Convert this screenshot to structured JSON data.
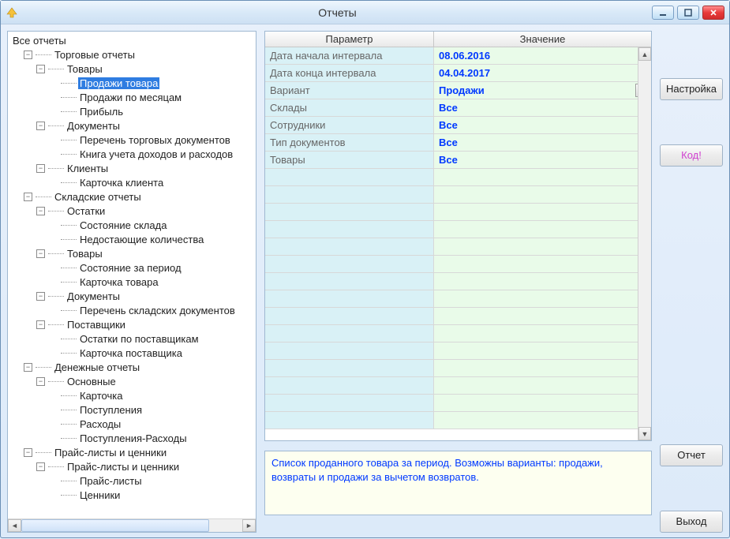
{
  "window": {
    "title": "Отчеты",
    "min_tip": "Свернуть",
    "max_tip": "Развернуть",
    "close_tip": "Закрыть"
  },
  "tree": {
    "root_label": "Все отчеты",
    "groups": [
      {
        "label": "Торговые отчеты",
        "children": [
          {
            "label": "Товары",
            "children": [
              {
                "label": "Продажи товара",
                "selected": true
              },
              {
                "label": "Продажи по месяцам"
              },
              {
                "label": "Прибыль"
              }
            ]
          },
          {
            "label": "Документы",
            "children": [
              {
                "label": "Перечень торговых документов"
              },
              {
                "label": "Книга учета доходов и расходов"
              }
            ]
          },
          {
            "label": "Клиенты",
            "children": [
              {
                "label": "Карточка клиента"
              }
            ]
          }
        ]
      },
      {
        "label": "Складские отчеты",
        "children": [
          {
            "label": "Остатки",
            "children": [
              {
                "label": "Состояние склада"
              },
              {
                "label": "Недостающие количества"
              }
            ]
          },
          {
            "label": "Товары",
            "children": [
              {
                "label": "Состояние за период"
              },
              {
                "label": "Карточка товара"
              }
            ]
          },
          {
            "label": "Документы",
            "children": [
              {
                "label": "Перечень складских документов"
              }
            ]
          },
          {
            "label": "Поставщики",
            "children": [
              {
                "label": "Остатки по поставщикам"
              },
              {
                "label": "Карточка поставщика"
              }
            ]
          }
        ]
      },
      {
        "label": "Денежные отчеты",
        "children": [
          {
            "label": "Основные",
            "children": [
              {
                "label": "Карточка"
              },
              {
                "label": "Поступления"
              },
              {
                "label": "Расходы"
              },
              {
                "label": "Поступления-Расходы"
              }
            ]
          }
        ]
      },
      {
        "label": "Прайс-листы и ценники",
        "children": [
          {
            "label": "Прайс-листы и ценники",
            "children": [
              {
                "label": "Прайс-листы"
              },
              {
                "label": "Ценники"
              }
            ]
          }
        ]
      }
    ]
  },
  "grid": {
    "header_param": "Параметр",
    "header_value": "Значение",
    "rows": [
      {
        "param": "Дата начала интервала",
        "value": "08.06.2016",
        "dropdown": false
      },
      {
        "param": "Дата конца интервала",
        "value": "04.04.2017",
        "dropdown": false
      },
      {
        "param": "Вариант",
        "value": "Продажи",
        "dropdown": true
      },
      {
        "param": "Склады",
        "value": "Все",
        "dropdown": false
      },
      {
        "param": "Сотрудники",
        "value": "Все",
        "dropdown": false
      },
      {
        "param": "Тип документов",
        "value": "Все",
        "dropdown": false
      },
      {
        "param": "Товары",
        "value": "Все",
        "dropdown": false
      }
    ],
    "blank_rows": 15
  },
  "description": "Список проданного товара за период. Возможны варианты: продажи, возвраты и продажи за вычетом возвратов.",
  "buttons": {
    "settings": "Настройка",
    "code": "Код!",
    "report": "Отчет",
    "exit": "Выход"
  }
}
